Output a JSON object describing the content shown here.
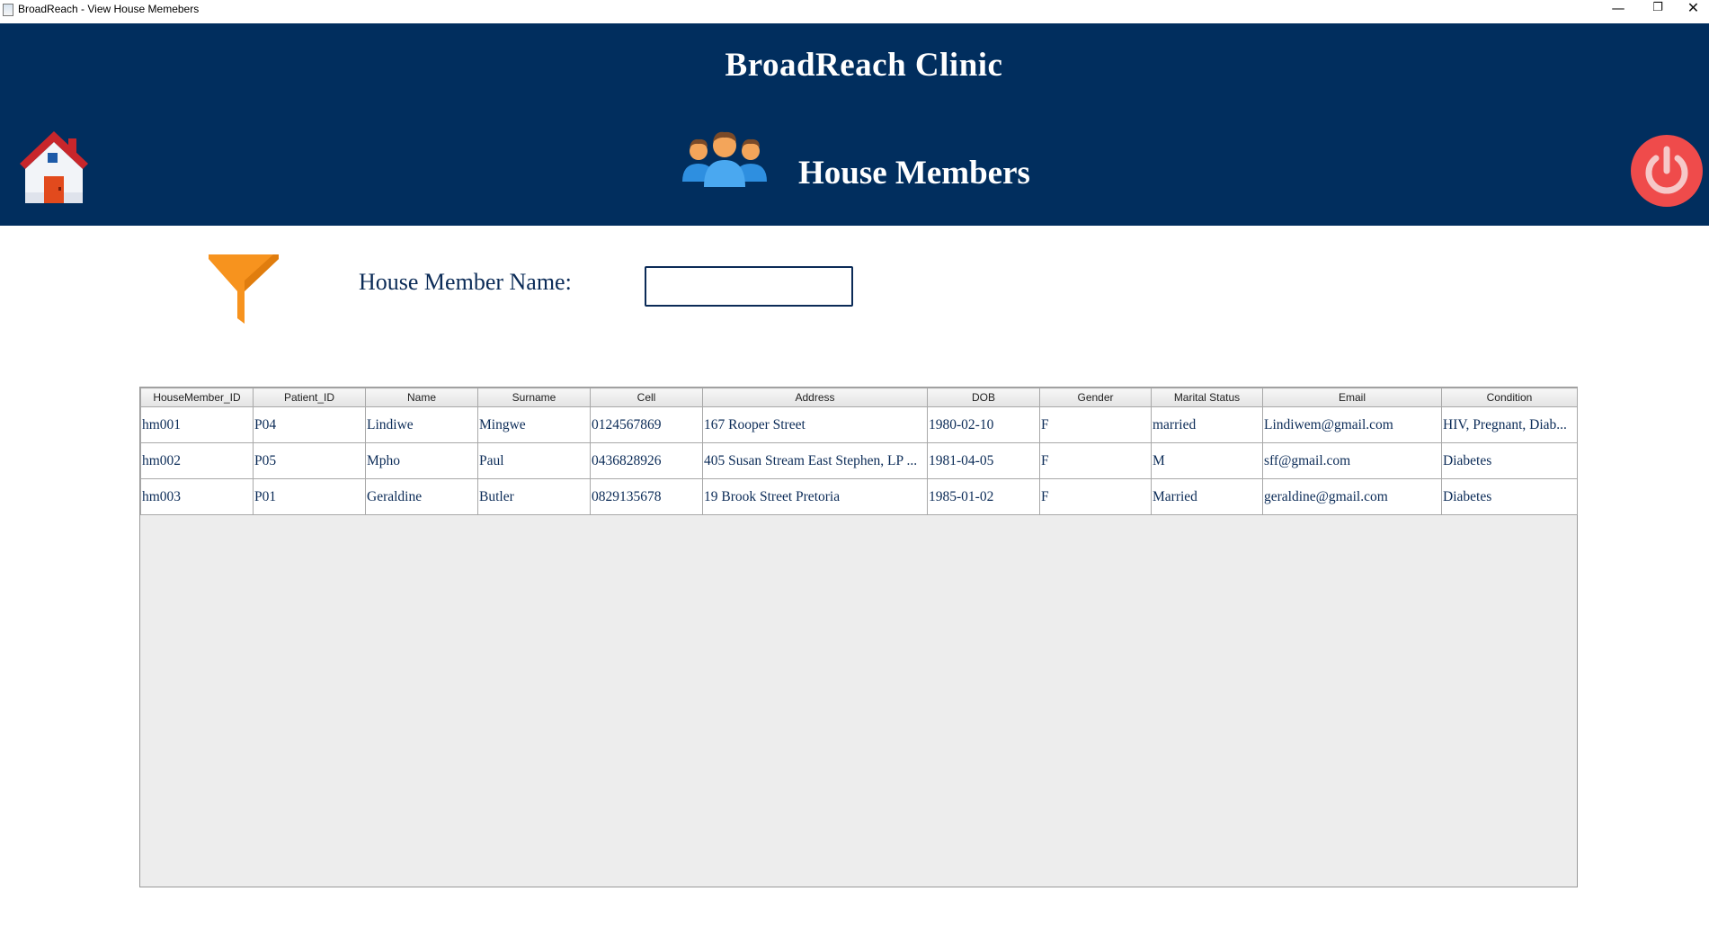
{
  "window": {
    "title": "BroadReach - View House Memebers",
    "minimize": "—",
    "restore": "❐",
    "close": "✕"
  },
  "header": {
    "clinic_name": "BroadReach Clinic",
    "page_title": "House Members",
    "icons": {
      "home": "home-icon",
      "members": "people-group-icon",
      "logout": "power-icon"
    },
    "colors": {
      "background": "#012e5e",
      "power": "#ef4b4b"
    }
  },
  "filter": {
    "icon": "funnel-icon",
    "label": "House Member Name:",
    "value": "",
    "icon_color": "#f7931e"
  },
  "table": {
    "columns": [
      "HouseMember_ID",
      "Patient_ID",
      "Name",
      "Surname",
      "Cell",
      "Address",
      "DOB",
      "Gender",
      "Marital Status",
      "Email",
      "Condition"
    ],
    "rows": [
      [
        "hm001",
        "P04",
        "Lindiwe",
        "Mingwe",
        "0124567869",
        "167 Rooper Street",
        "1980-02-10",
        "F",
        "married",
        "Lindiwem@gmail.com",
        "HIV, Pregnant, Diab..."
      ],
      [
        "hm002",
        "P05",
        "Mpho",
        " Paul",
        "0436828926",
        "405 Susan Stream East Stephen, LP ...",
        "1981-04-05",
        "F",
        "M",
        "sff@gmail.com",
        "Diabetes"
      ],
      [
        "hm003",
        "P01",
        "Geraldine",
        "Butler",
        "0829135678",
        "19 Brook Street Pretoria",
        "1985-01-02",
        "F",
        "Married",
        "geraldine@gmail.com",
        "Diabetes"
      ]
    ]
  }
}
